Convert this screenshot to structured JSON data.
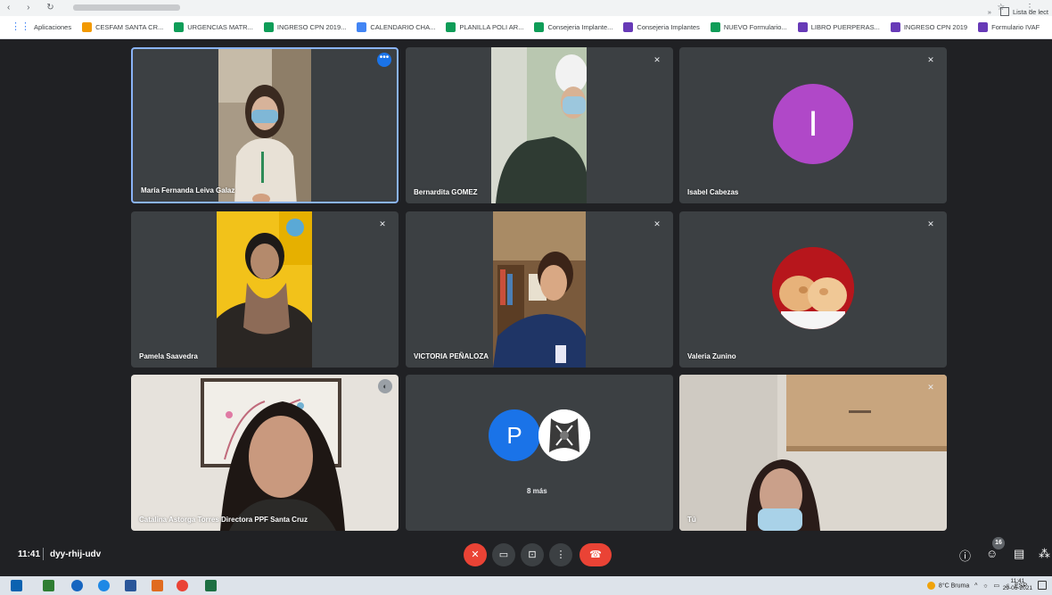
{
  "bookmarks": [
    {
      "label": "Aplicaciones",
      "icon": "apps-grid-icon",
      "color": "#4285f4"
    },
    {
      "label": "CESFAM SANTA CR...",
      "icon": "bookmark-icon",
      "color": "#f29900"
    },
    {
      "label": "URGENCIAS MATR...",
      "icon": "sheets-icon",
      "color": "#0f9d58"
    },
    {
      "label": "INGRESO CPN 2019...",
      "icon": "sheets-icon",
      "color": "#0f9d58"
    },
    {
      "label": "CALENDARIO CHA...",
      "icon": "docs-icon",
      "color": "#4285f4"
    },
    {
      "label": "PLANILLA POLI AR...",
      "icon": "sheets-icon",
      "color": "#0f9d58"
    },
    {
      "label": "Consejeria Implante...",
      "icon": "sheets-icon",
      "color": "#0f9d58"
    },
    {
      "label": "Consejeria Implantes",
      "icon": "forms-icon",
      "color": "#673ab7"
    },
    {
      "label": "NUEVO Formulario...",
      "icon": "sheets-icon",
      "color": "#0f9d58"
    },
    {
      "label": "LIBRO PUERPERAS...",
      "icon": "forms-icon",
      "color": "#673ab7"
    },
    {
      "label": "INGRESO CPN 2019",
      "icon": "forms-icon",
      "color": "#673ab7"
    },
    {
      "label": "Formulario IVAF",
      "icon": "forms-icon",
      "color": "#673ab7"
    }
  ],
  "bookmarks_more": "»",
  "reading_list": "Lista de lect",
  "participants": [
    {
      "name": "María Fernanda Leiva Galaz",
      "type": "video",
      "active": true
    },
    {
      "name": "Bernardita GOMEZ",
      "type": "video"
    },
    {
      "name": "Isabel Cabezas",
      "type": "letter",
      "letter": "I",
      "color": "#b048c8"
    },
    {
      "name": "Pamela Saavedra",
      "type": "video"
    },
    {
      "name": "VICTORIA PEÑALOZA",
      "type": "video"
    },
    {
      "name": "Valeria Zunino",
      "type": "photo"
    },
    {
      "name": "Catalina Astorga Torres Directora PPF Santa Cruz",
      "type": "video"
    },
    {
      "name": "",
      "type": "others",
      "letter": "P",
      "more_label": "8 más"
    },
    {
      "name": "Tú",
      "type": "video"
    }
  ],
  "meeting": {
    "time": "11:41",
    "code": "dyy-rhij-udv",
    "people_count": "16"
  },
  "taskbar": {
    "weather": "8°C Bruma",
    "lang": "ESP",
    "time": "11:41",
    "date": "29-06-2021"
  }
}
